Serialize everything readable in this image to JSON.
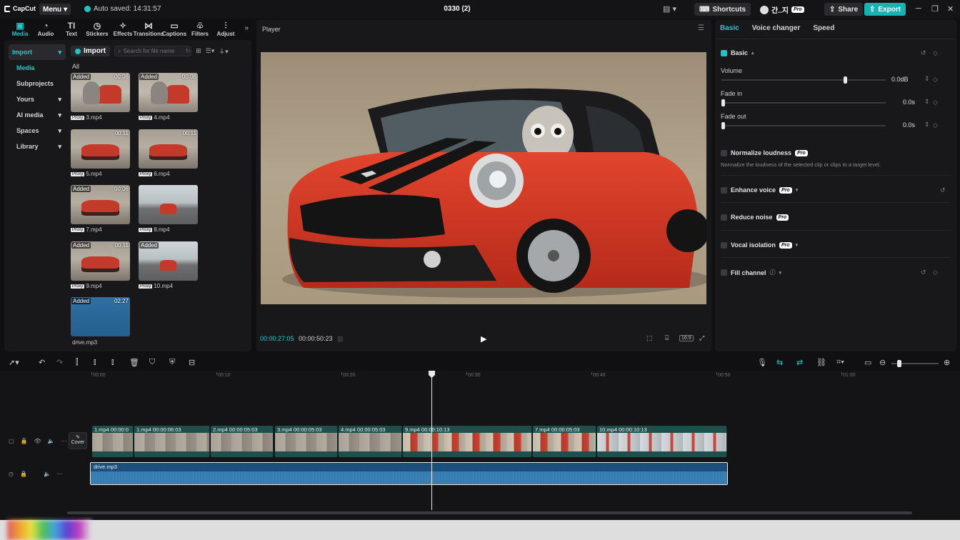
{
  "titlebar": {
    "app_name": "CapCut",
    "menu_label": "Menu",
    "autosave": "Auto saved: 14:31:57",
    "project_title": "0330 (2)",
    "shortcuts_label": "Shortcuts",
    "account_name": "간..지",
    "pro_badge": "Pro",
    "share_label": "Share",
    "export_label": "Export"
  },
  "tools": [
    {
      "label": "Media",
      "icon": "media-icon",
      "active": true
    },
    {
      "label": "Audio",
      "icon": "audio-icon"
    },
    {
      "label": "Text",
      "icon": "text-icon"
    },
    {
      "label": "Stickers",
      "icon": "stickers-icon"
    },
    {
      "label": "Effects",
      "icon": "effects-icon"
    },
    {
      "label": "Transitions",
      "icon": "transitions-icon"
    },
    {
      "label": "Captions",
      "icon": "captions-icon"
    },
    {
      "label": "Filters",
      "icon": "filters-icon"
    },
    {
      "label": "Adjust",
      "icon": "adjust-icon"
    }
  ],
  "sidebar": {
    "items": [
      {
        "label": "Import"
      },
      {
        "label": "Media"
      },
      {
        "label": "Subprojects"
      },
      {
        "label": "Yours"
      },
      {
        "label": "AI media"
      },
      {
        "label": "Spaces"
      },
      {
        "label": "Library"
      }
    ]
  },
  "media": {
    "import_label": "Import",
    "search_placeholder": "Search for file name",
    "filter_label": "All",
    "items": [
      {
        "name": "3.mp4",
        "status": "Added",
        "duration": "00:06",
        "proxy": "Proxy",
        "kind": "cat"
      },
      {
        "name": "4.mp4",
        "status": "Added",
        "duration": "00:06",
        "proxy": "Proxy",
        "kind": "cat"
      },
      {
        "name": "5.mp4",
        "status": "",
        "duration": "00:11",
        "proxy": "Proxy",
        "kind": "car"
      },
      {
        "name": "6.mp4",
        "status": "",
        "duration": "00:11",
        "proxy": "Proxy",
        "kind": "car"
      },
      {
        "name": "7.mp4",
        "status": "Added",
        "duration": "00:06",
        "proxy": "Proxy",
        "kind": "car"
      },
      {
        "name": "8.mp4",
        "status": "",
        "duration": "",
        "proxy": "Proxy",
        "kind": "road"
      },
      {
        "name": "9.mp4",
        "status": "Added",
        "duration": "00:11",
        "proxy": "Proxy",
        "kind": "car"
      },
      {
        "name": "10.mp4",
        "status": "Added",
        "duration": "",
        "proxy": "Proxy",
        "kind": "road"
      },
      {
        "name": "drive.mp3",
        "status": "Added",
        "duration": "02:27",
        "proxy": "",
        "kind": "audio"
      }
    ]
  },
  "player": {
    "title": "Player",
    "current_time": "00:00:27:05",
    "total_time": "00:00:50:23",
    "ratio_label": "16:9"
  },
  "inspector": {
    "tabs": [
      "Basic",
      "Voice changer",
      "Speed"
    ],
    "section_title": "Basic",
    "volume": {
      "label": "Volume",
      "value": "0.0dB",
      "level": 0.76
    },
    "fade_in": {
      "label": "Fade in",
      "value": "0.0s",
      "level": 0
    },
    "fade_out": {
      "label": "Fade out",
      "value": "0.0s",
      "level": 0
    },
    "normalize": {
      "label": "Normalize loudness",
      "desc": "Normalize the loudness of the selected clip or clips to a target level."
    },
    "enhance": {
      "label": "Enhance voice"
    },
    "reduce": {
      "label": "Reduce noise"
    },
    "vocal": {
      "label": "Vocal isolation"
    },
    "fill": {
      "label": "Fill channel"
    },
    "pro": "Pro"
  },
  "timeline": {
    "ruler": [
      "00:00",
      "00:10",
      "00:20",
      "00:30",
      "00:40",
      "00:50",
      "01:00"
    ],
    "cover_label": "Cover",
    "clips": [
      {
        "label": "1.mp4  00:00:0",
        "kind": "cat"
      },
      {
        "label": "1.mp4  00:00:06:03",
        "kind": "cat"
      },
      {
        "label": "2.mp4  00:00:05:03",
        "kind": "cat"
      },
      {
        "label": "3.mp4  00:00:05:03",
        "kind": "cat"
      },
      {
        "label": "4.mp4  00:00:05:03",
        "kind": "cat"
      },
      {
        "label": "9.mp4  00:00:10:13",
        "kind": "red"
      },
      {
        "label": "7.mp4  00:00:05:03",
        "kind": "red"
      },
      {
        "label": "10.mp4  00:00:10:13",
        "kind": "road"
      }
    ],
    "audio_label": "drive.mp3"
  },
  "colors": {
    "accent": "#22c8c8",
    "export": "#17b3b4",
    "audio_clip": "#1c4f7a",
    "video_clip": "#1f4f4d"
  }
}
